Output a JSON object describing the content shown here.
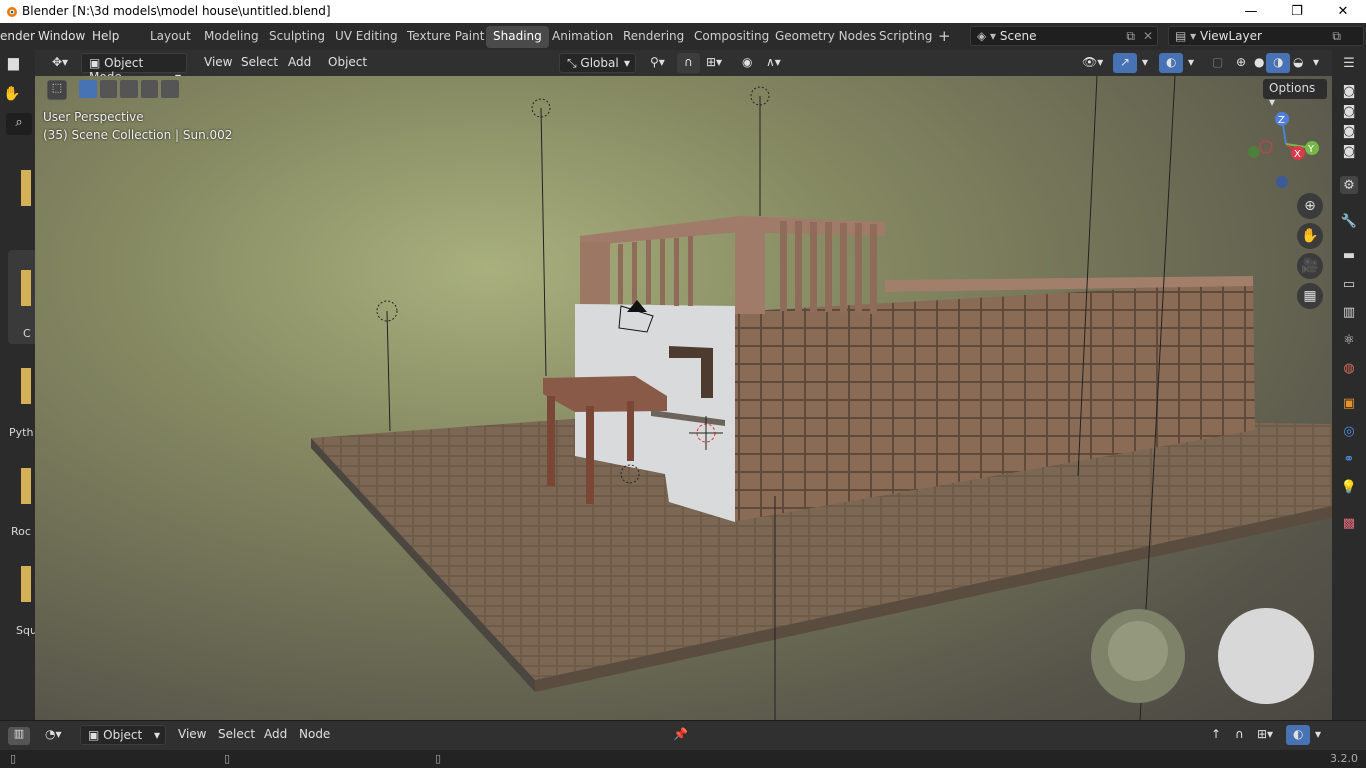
{
  "window": {
    "title": "Blender [N:\\3d models\\model house\\untitled.blend]",
    "minimize": "—",
    "restore": "❐",
    "close": "✕"
  },
  "menu": {
    "render": "ender",
    "window": "Window",
    "help": "Help"
  },
  "workspaces": [
    "Layout",
    "Modeling",
    "Sculpting",
    "UV Editing",
    "Texture Paint",
    "Shading",
    "Animation",
    "Rendering",
    "Compositing",
    "Geometry Nodes",
    "Scripting"
  ],
  "active_workspace": "Shading",
  "add_workspace": "+",
  "scene": {
    "name": "Scene"
  },
  "view_layer": {
    "name": "ViewLayer"
  },
  "viewport_header": {
    "mode": "Object Mode",
    "view": "View",
    "select": "Select",
    "add": "Add",
    "object": "Object",
    "orientation": "Global",
    "options": "Options"
  },
  "viewport_overlay": {
    "perspective": "User Perspective",
    "collection": "(35) Scene Collection | Sun.002"
  },
  "gizmo": {
    "z": "Z",
    "y": "Y",
    "x": "X"
  },
  "left_panel_labels": [
    "C",
    "Pyth",
    "Roc",
    "Squ"
  ],
  "shader_header": {
    "type": "Object",
    "view": "View",
    "select": "Select",
    "add": "Node",
    "add_label": "Add"
  },
  "status": {
    "version": "3.2.0"
  },
  "colors": {
    "active_tab": "#4a4a4a",
    "accent_blue": "#4772b3",
    "floor": "#6b5a48",
    "wall": "#8a6a55"
  }
}
